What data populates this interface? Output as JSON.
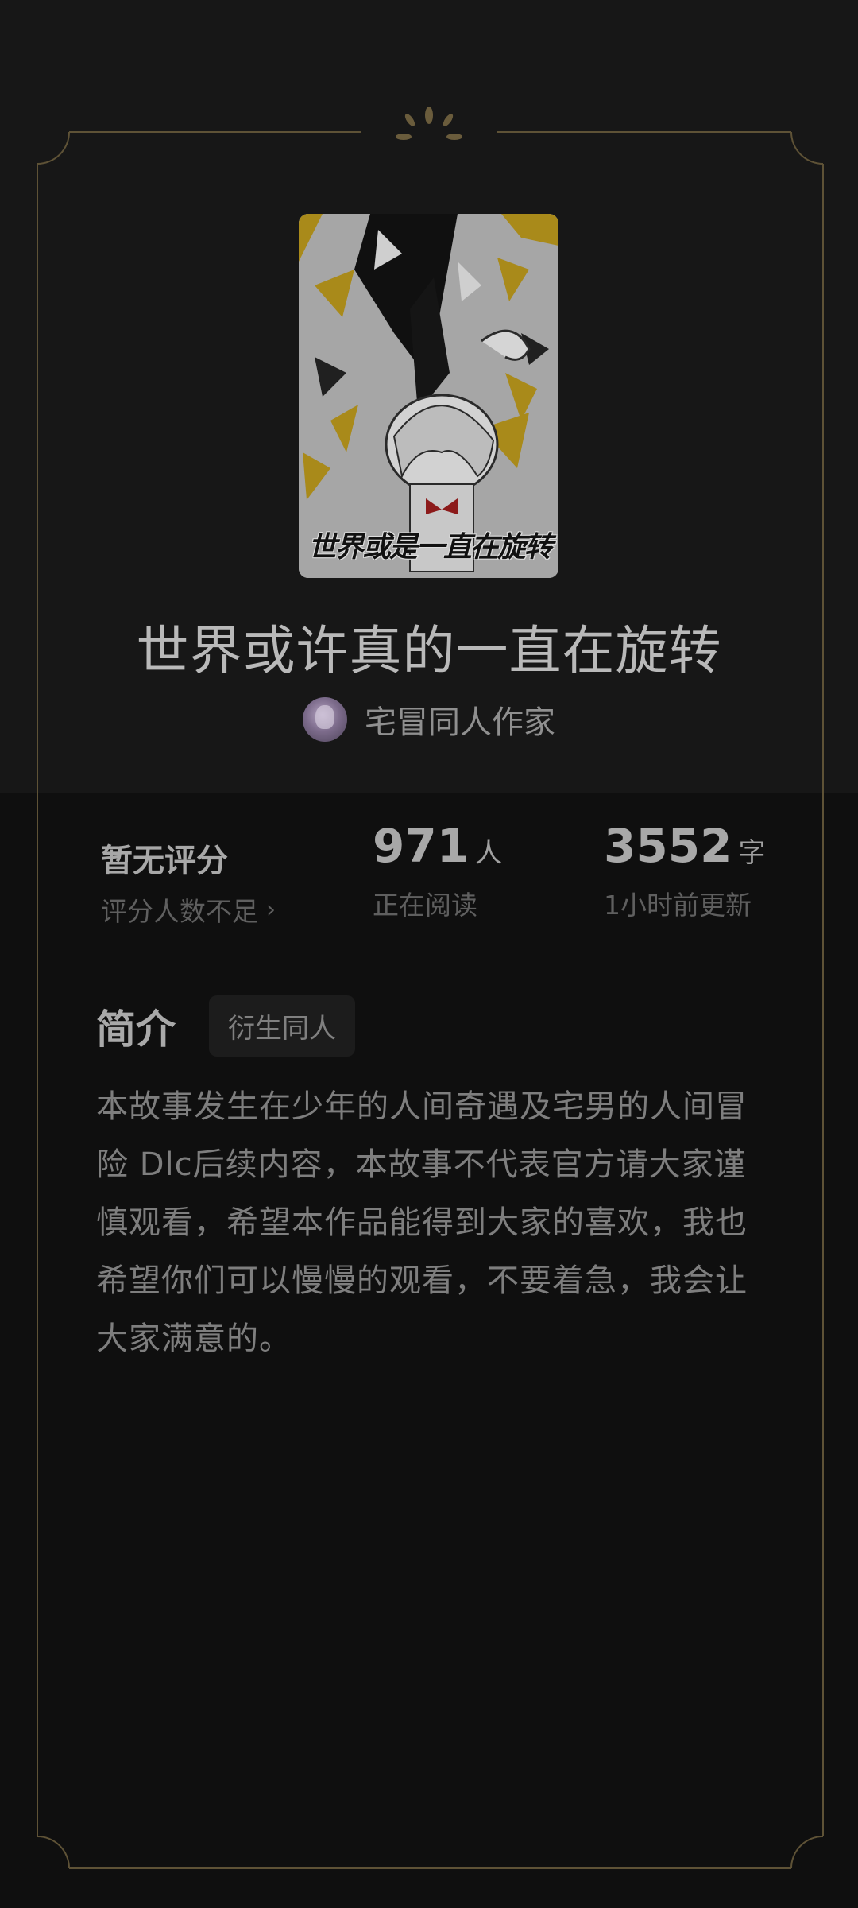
{
  "book": {
    "cover_title": "世界或是一直在旋转",
    "title": "世界或许真的一直在旋转",
    "author": "宅冒同人作家"
  },
  "stats": {
    "rating": {
      "label": "暂无评分",
      "sub": "评分人数不足"
    },
    "readers": {
      "value": "971",
      "unit": "人",
      "sub": "正在阅读"
    },
    "words": {
      "value": "3552",
      "unit": "字",
      "sub": "1小时前更新"
    }
  },
  "intro": {
    "label": "简介",
    "tag": "衍生同人",
    "text": "本故事发生在少年的人间奇遇及宅男的人间冒险 Dlc后续内容，本故事不代表官方请大家谨慎观看，希望本作品能得到大家的喜欢，我也希望你们可以慢慢的观看，不要着急，我会让大家满意的。"
  },
  "icons": {
    "chevron": "chevron-right-icon",
    "ornament": "flourish-ornament-icon"
  },
  "colors": {
    "background": "#0f0f0f",
    "frame_gold": "#5e5236",
    "text_primary": "#b9b9b9",
    "text_secondary": "#7e7e7e"
  }
}
